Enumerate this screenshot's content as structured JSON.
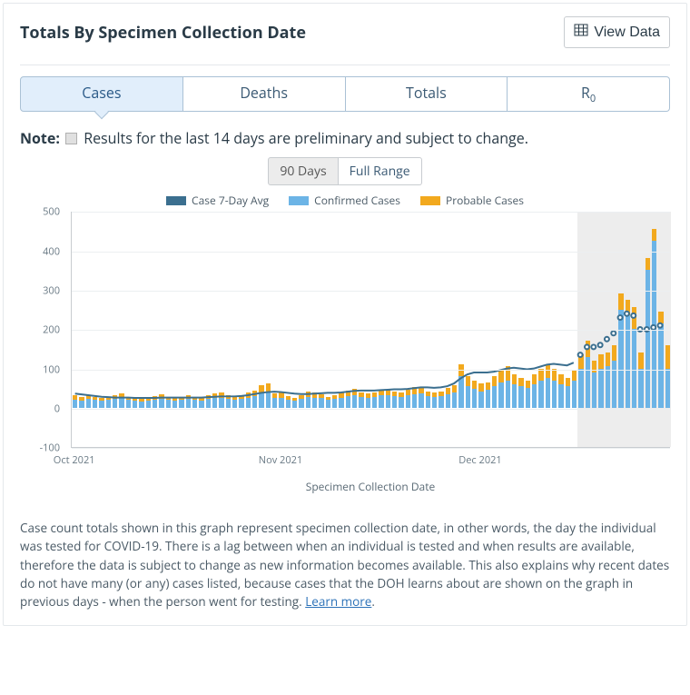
{
  "header": {
    "title": "Totals By Specimen Collection Date",
    "view_data": "View Data"
  },
  "tabs": [
    {
      "label": "Cases",
      "active": true
    },
    {
      "label": "Deaths",
      "active": false
    },
    {
      "label": "Totals",
      "active": false
    },
    {
      "label": "R",
      "sub": "0",
      "active": false
    }
  ],
  "note": {
    "label": "Note:",
    "text": "Results for the last 14 days are preliminary and subject to change."
  },
  "range_toggle": {
    "opt1": "90 Days",
    "opt2": "Full Range",
    "active": "90 Days"
  },
  "legend": {
    "avg": {
      "label": "Case 7-Day Avg",
      "color": "#3b6f8f"
    },
    "conf": {
      "label": "Confirmed Cases",
      "color": "#6cb4e6"
    },
    "prob": {
      "label": "Probable Cases",
      "color": "#f2a91e"
    }
  },
  "description": {
    "text": "Case count totals shown in this graph represent specimen collection date, in other words, the day the individual was tested for COVID-19. There is a lag between when an individual is tested and when results are available, therefore the data is subject to change as new information becomes available. This also explains why recent dates do not have many (or any) cases listed, because cases that the DOH learns about are shown on the graph in previous days - when the person went for testing. ",
    "link_text": "Learn more",
    "suffix": "."
  },
  "chart_data": {
    "type": "bar",
    "xlabel": "Specimen Collection Date",
    "ylabel": "",
    "ylim": [
      -100,
      500
    ],
    "yticks": [
      -100,
      0,
      100,
      200,
      300,
      400,
      500
    ],
    "xticks": [
      "Oct 2021",
      "Nov 2021",
      "Dec 2021"
    ],
    "xtick_indices": [
      0,
      31,
      61
    ],
    "preliminary_from_index": 76,
    "total_days": 90,
    "series": [
      {
        "name": "Confirmed Cases",
        "values": [
          20,
          18,
          22,
          20,
          18,
          20,
          22,
          24,
          20,
          18,
          16,
          18,
          20,
          22,
          20,
          18,
          20,
          22,
          20,
          18,
          22,
          24,
          26,
          22,
          20,
          22,
          26,
          30,
          40,
          42,
          24,
          26,
          20,
          18,
          22,
          28,
          26,
          24,
          20,
          22,
          26,
          30,
          32,
          28,
          26,
          28,
          32,
          32,
          30,
          28,
          32,
          34,
          36,
          30,
          28,
          30,
          35,
          38,
          80,
          55,
          48,
          42,
          45,
          55,
          65,
          70,
          60,
          55,
          50,
          60,
          70,
          75,
          70,
          60,
          55,
          70,
          100,
          130,
          90,
          100,
          105,
          120,
          250,
          235,
          200,
          100,
          350,
          425,
          215,
          100
        ]
      },
      {
        "name": "Probable Cases",
        "values": [
          12,
          10,
          10,
          8,
          6,
          8,
          10,
          12,
          8,
          6,
          6,
          8,
          10,
          12,
          8,
          6,
          8,
          10,
          8,
          6,
          10,
          12,
          14,
          10,
          8,
          10,
          12,
          14,
          18,
          20,
          12,
          12,
          10,
          8,
          10,
          14,
          12,
          10,
          8,
          10,
          12,
          14,
          16,
          12,
          10,
          12,
          14,
          14,
          12,
          12,
          14,
          18,
          16,
          12,
          10,
          12,
          15,
          20,
          30,
          25,
          22,
          20,
          20,
          25,
          30,
          35,
          25,
          20,
          20,
          25,
          30,
          35,
          30,
          25,
          20,
          25,
          35,
          40,
          30,
          35,
          35,
          40,
          40,
          40,
          55,
          40,
          30,
          30,
          30,
          60
        ]
      }
    ],
    "avg_7day": [
      36,
      34,
      32,
      30,
      28,
      27,
      26,
      26,
      26,
      25,
      25,
      25,
      25,
      26,
      26,
      26,
      26,
      26,
      26,
      26,
      27,
      28,
      29,
      29,
      29,
      30,
      32,
      35,
      38,
      40,
      41,
      40,
      38,
      36,
      35,
      35,
      36,
      37,
      38,
      38,
      39,
      41,
      43,
      44,
      44,
      44,
      45,
      46,
      47,
      47,
      48,
      50,
      52,
      52,
      51,
      52,
      55,
      62,
      75,
      85,
      90,
      90,
      90,
      92,
      96,
      100,
      102,
      100,
      98,
      100,
      105,
      110,
      112,
      110,
      108,
      115,
      null,
      null,
      null,
      null,
      null,
      null,
      null,
      null,
      null,
      null,
      null,
      null,
      null,
      null
    ],
    "avg_7day_hollow": [
      null,
      null,
      null,
      null,
      null,
      null,
      null,
      null,
      null,
      null,
      null,
      null,
      null,
      null,
      null,
      null,
      null,
      null,
      null,
      null,
      null,
      null,
      null,
      null,
      null,
      null,
      null,
      null,
      null,
      null,
      null,
      null,
      null,
      null,
      null,
      null,
      null,
      null,
      null,
      null,
      null,
      null,
      null,
      null,
      null,
      null,
      null,
      null,
      null,
      null,
      null,
      null,
      null,
      null,
      null,
      null,
      null,
      null,
      null,
      null,
      null,
      null,
      null,
      null,
      null,
      null,
      null,
      null,
      null,
      null,
      null,
      null,
      null,
      null,
      null,
      null,
      135,
      155,
      155,
      160,
      175,
      190,
      230,
      240,
      235,
      200,
      200,
      205,
      210,
      null
    ]
  }
}
